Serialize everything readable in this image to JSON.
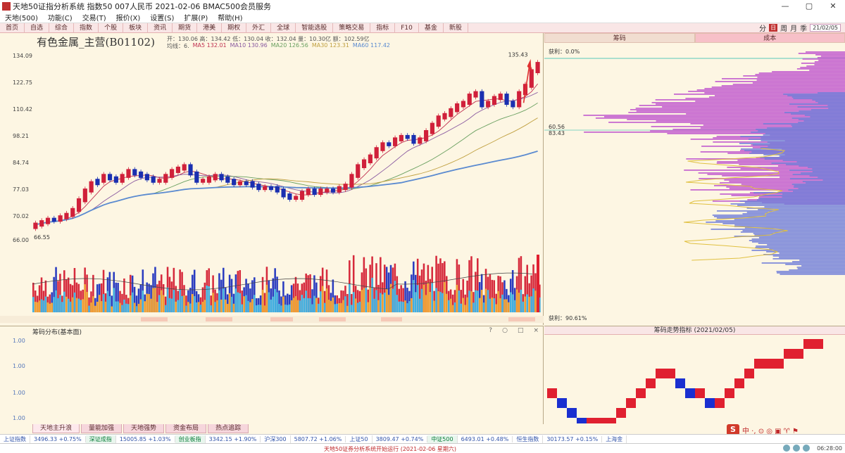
{
  "window": {
    "title": "天地50证指分析系统 指数50 007人民币 2021-02-06 BMAC500会员服务",
    "buttons": [
      "—",
      "▢",
      "✕"
    ]
  },
  "menu": [
    "天地(500)",
    "功能(C)",
    "交易(T)",
    "报价(X)",
    "设置(S)",
    "扩展(P)",
    "帮助(H)"
  ],
  "toolbar": {
    "items": [
      "首页",
      "自选",
      "综合",
      "指数",
      "个股",
      "板块",
      "资讯",
      "期货",
      "港美",
      "期权",
      "外汇",
      "全球",
      "智能选股",
      "策略交易",
      "指标",
      "F10",
      "基金",
      "新股"
    ],
    "right_items": [
      "分",
      "日",
      "周",
      "月",
      "季"
    ],
    "date_pill": "21/02/05"
  },
  "main_chart": {
    "instrument": "有色金属_主营(B01102)",
    "ohlc": "开：130.06  高：134.42  低：130.04  收：132.04  量：10.30亿  额：102.59亿",
    "ma_prefix": "均线：6.",
    "ma_values": [
      "MA5 132.01",
      "MA10 130.96",
      "MA20 126.56",
      "MA30 123.31",
      "MA60 117.42"
    ],
    "ma_colors": [
      "#c03050",
      "#8a5aa0",
      "#6aa060",
      "#c0a040",
      "#5a8ad0"
    ],
    "peak_label": "135.43",
    "low_label": "66.55",
    "y_labels": [
      "134.09",
      "122.75",
      "110.42",
      "98.21",
      "84.74",
      "77.03",
      "70.02",
      "66.00"
    ],
    "chart_data": {
      "type": "candlestick",
      "title": "有色金属_主营(B01102)",
      "ylim": [
        60,
        138
      ],
      "close": [
        68,
        69,
        70,
        70,
        71,
        72,
        74,
        78,
        82,
        85,
        86,
        88,
        87,
        86,
        88,
        90,
        89,
        88,
        87,
        86,
        86,
        88,
        90,
        91,
        92,
        89,
        86,
        86,
        87,
        88,
        87,
        86,
        85,
        85,
        85,
        84,
        83,
        83,
        83,
        82,
        80,
        79,
        79,
        81,
        82,
        81,
        82,
        82,
        82,
        83,
        84,
        88,
        92,
        94,
        96,
        99,
        101,
        101,
        103,
        104,
        104,
        102,
        103,
        106,
        109,
        112,
        113,
        115,
        117,
        118,
        121,
        122,
        117,
        118,
        120,
        121,
        118,
        117,
        122,
        125,
        131,
        134
      ],
      "up": [
        1,
        1,
        1,
        0,
        1,
        1,
        1,
        1,
        1,
        1,
        0,
        1,
        0,
        0,
        1,
        1,
        0,
        0,
        0,
        0,
        1,
        1,
        1,
        1,
        1,
        0,
        0,
        1,
        1,
        1,
        0,
        0,
        0,
        1,
        0,
        0,
        0,
        1,
        0,
        0,
        0,
        0,
        1,
        1,
        1,
        0,
        1,
        1,
        0,
        1,
        1,
        1,
        1,
        1,
        1,
        1,
        1,
        0,
        1,
        1,
        0,
        0,
        1,
        1,
        1,
        1,
        1,
        1,
        1,
        1,
        1,
        1,
        0,
        1,
        1,
        1,
        0,
        0,
        1,
        1,
        1,
        1
      ]
    }
  },
  "right_panel": {
    "tabs": [
      "筹码",
      "成本"
    ],
    "top_label": "获利：0.0%",
    "mid_labels": [
      "60.56",
      "83.43"
    ],
    "bottom_label": "获利：90.61%"
  },
  "lower_left": {
    "title": "筹码分布(基本面)",
    "icons": [
      "?",
      "○",
      "□",
      "×"
    ],
    "y_labels": [
      "1.00",
      "1.00",
      "1.00",
      "1.00"
    ]
  },
  "lower_right": {
    "title": "筹码走势指标 (2021/02/05)",
    "chart_data": {
      "type": "step",
      "values": [
        3,
        2,
        1,
        0,
        0,
        0,
        0,
        1,
        2,
        3,
        4,
        5,
        5,
        4,
        3,
        3,
        2,
        2,
        3,
        4,
        5,
        6,
        6,
        6,
        7,
        7,
        8,
        8
      ]
    }
  },
  "bottom_tabs": [
    "天地主升浪",
    "量能加强",
    "天地强势",
    "资金布局",
    "热点追踪"
  ],
  "brand": {
    "logo": "S",
    "text": "中 ·, ⊙ ◎ ▣ ♈ ⚑"
  },
  "ticker": [
    "上证指数",
    "3496.33 +0.75%",
    "深证成指",
    "15005.85 +1.03%",
    "创业板指",
    "3342.15 +1.90%",
    "沪深300",
    "5807.72 +1.06%",
    "上证50",
    "3809.47 +0.74%",
    "中证500",
    "6493.01 +0.48%",
    "恒生指数",
    "30173.57 +0.15%",
    "上海金"
  ],
  "ticker_highlight": [
    2,
    4,
    10
  ],
  "status": {
    "message": "天地50证券分析系统开始运行 (2021-02-06 星期六)",
    "clock": "06:28:00"
  }
}
